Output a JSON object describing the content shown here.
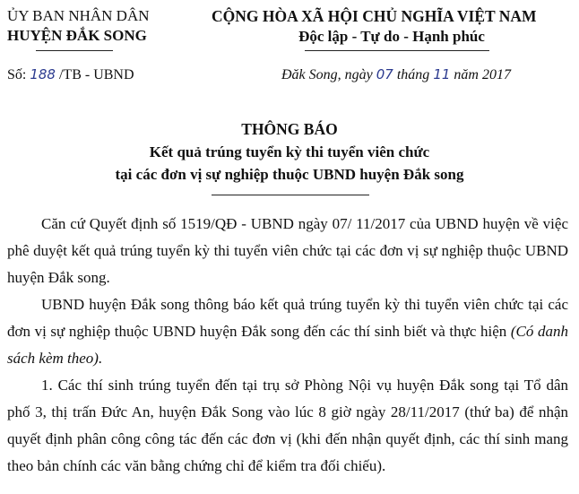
{
  "header": {
    "org_line1": "ỦY BAN NHÂN DÂN",
    "org_line2": "HUYỆN ĐẮK SONG",
    "country": "CỘNG HÒA XÃ HỘI CHỦ NGHĨA VIỆT NAM",
    "motto": "Độc lập - Tự do - Hạnh phúc",
    "doc_no_prefix": "Số:",
    "doc_no_handwritten": "188",
    "doc_no_suffix": "/TB - UBND",
    "date_prefix": "Đăk Song, ngày",
    "date_day": "07",
    "date_month_label": "tháng",
    "date_month": "11",
    "date_year_label": "năm 2017"
  },
  "title": {
    "main": "THÔNG BÁO",
    "sub1": "Kết quả trúng tuyển kỳ thi tuyển viên chức",
    "sub2": "tại các đơn vị sự nghiệp thuộc UBND huyện Đắk song"
  },
  "body": {
    "p1": "Căn cứ Quyết định số 1519/QĐ - UBND ngày 07/ 11/2017 của UBND huyện về việc phê duyệt kết quả trúng tuyển kỳ thi tuyển viên chức tại các đơn vị sự nghiệp thuộc UBND huyện Đắk song.",
    "p2": "UBND huyện Đắk song thông báo kết quả trúng tuyển kỳ thi tuyển viên chức tại các đơn vị sự nghiệp thuộc UBND huyện Đắk song đến các thí sinh biết và thực hiện",
    "p2_italic": "(Có danh sách kèm theo).",
    "p3": "1. Các thí sinh trúng tuyển đến tại trụ sở Phòng Nội vụ huyện Đắk song tại Tổ dân phố 3, thị trấn Đức An, huyện Đắk Song vào lúc 8 giờ ngày 28/11/2017 (thứ ba) để nhận quyết định phân công công tác đến các đơn vị (khi đến nhận quyết định, các thí sinh mang theo bản chính các văn bằng chứng chỉ để kiểm tra đối chiếu)."
  }
}
